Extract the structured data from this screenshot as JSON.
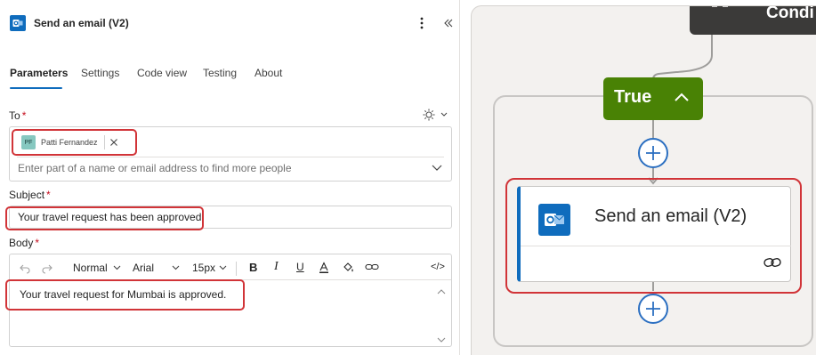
{
  "panel": {
    "title": "Send an email (V2)",
    "tabs": [
      {
        "label": "Parameters",
        "active": true
      },
      {
        "label": "Settings"
      },
      {
        "label": "Code view"
      },
      {
        "label": "Testing"
      },
      {
        "label": "About"
      }
    ]
  },
  "to": {
    "label": "To",
    "required_mark": "*",
    "chip_initials": "PF",
    "chip_name": "Patti Fernandez",
    "placeholder": "Enter part of a name or email address to find more people"
  },
  "subject": {
    "label": "Subject",
    "required_mark": "*",
    "value": "Your travel request has been approved."
  },
  "body": {
    "label": "Body",
    "required_mark": "*",
    "toolbar": {
      "style": "Normal",
      "font": "Arial",
      "size": "15px",
      "bold": "B",
      "italic": "I",
      "underline": "U",
      "code": "</>"
    },
    "value": "Your travel request for Mumbai is approved."
  },
  "canvas": {
    "condition_label": "Condi",
    "branch_label": "True",
    "action_title": "Send an email (V2)"
  },
  "colors": {
    "accent": "#0f6cbd",
    "highlight": "#d13438",
    "true_branch": "#498205",
    "condition_node": "#3b3a39"
  }
}
